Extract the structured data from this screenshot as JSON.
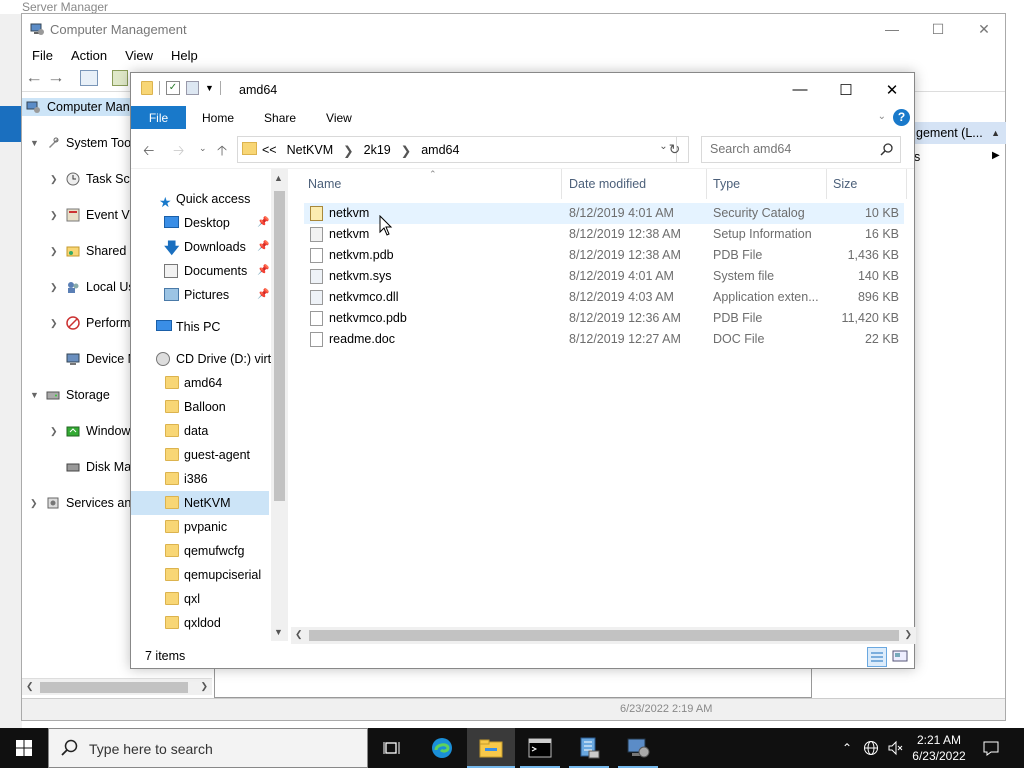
{
  "server_manager": {
    "title": "Server Manager"
  },
  "computer_management": {
    "title": "Computer Management",
    "menu": [
      "File",
      "Action",
      "View",
      "Help"
    ],
    "tree": [
      {
        "label": "Computer Man",
        "level": 0
      },
      {
        "label": "System Tool",
        "level": 1
      },
      {
        "label": "Task Sch",
        "level": 2
      },
      {
        "label": "Event Vi",
        "level": 2
      },
      {
        "label": "Shared F",
        "level": 2
      },
      {
        "label": "Local Us",
        "level": 2
      },
      {
        "label": "Perform",
        "level": 2
      },
      {
        "label": "Device M",
        "level": 2
      },
      {
        "label": "Storage",
        "level": 1
      },
      {
        "label": "Window",
        "level": 2
      },
      {
        "label": "Disk Mar",
        "level": 2
      },
      {
        "label": "Services anc",
        "level": 1
      }
    ],
    "actions_header": "gement (L...",
    "actions_item": "s",
    "status_text": "6/23/2022 2:19 AM"
  },
  "explorer": {
    "title": "amd64",
    "ribbon": {
      "file": "File",
      "tabs": [
        "Home",
        "Share",
        "View"
      ],
      "help": "?"
    },
    "address": {
      "overflow": "<<",
      "crumbs": [
        "NetKVM",
        "2k19",
        "amd64"
      ]
    },
    "search": {
      "placeholder": "Search amd64"
    },
    "nav": {
      "quick_access": "Quick access",
      "pinned": [
        "Desktop",
        "Downloads",
        "Documents",
        "Pictures"
      ],
      "this_pc": "This PC",
      "drive": "CD Drive (D:) virtio",
      "folders": [
        "amd64",
        "Balloon",
        "data",
        "guest-agent",
        "i386",
        "NetKVM",
        "pvpanic",
        "qemufwcfg",
        "qemupciserial",
        "qxl",
        "qxldod"
      ],
      "selected": "NetKVM"
    },
    "columns": {
      "name": "Name",
      "date": "Date modified",
      "type": "Type",
      "size": "Size"
    },
    "files": [
      {
        "name": "netkvm",
        "date": "8/12/2019 4:01 AM",
        "type": "Security Catalog",
        "size": "10 KB"
      },
      {
        "name": "netkvm",
        "date": "8/12/2019 12:38 AM",
        "type": "Setup Information",
        "size": "16 KB"
      },
      {
        "name": "netkvm.pdb",
        "date": "8/12/2019 12:38 AM",
        "type": "PDB File",
        "size": "1,436 KB"
      },
      {
        "name": "netkvm.sys",
        "date": "8/12/2019 4:01 AM",
        "type": "System file",
        "size": "140 KB"
      },
      {
        "name": "netkvmco.dll",
        "date": "8/12/2019 4:03 AM",
        "type": "Application exten...",
        "size": "896 KB"
      },
      {
        "name": "netkvmco.pdb",
        "date": "8/12/2019 12:36 AM",
        "type": "PDB File",
        "size": "11,420 KB"
      },
      {
        "name": "readme.doc",
        "date": "8/12/2019 12:27 AM",
        "type": "DOC File",
        "size": "22 KB"
      }
    ],
    "status": "7 items"
  },
  "taskbar": {
    "search_placeholder": "Type here to search",
    "time": "2:21 AM",
    "date": "6/23/2022"
  },
  "colors": {
    "accent": "#1979ca",
    "selection": "#cce4f7",
    "hover": "#e5f3ff",
    "folder": "#f8d675"
  }
}
